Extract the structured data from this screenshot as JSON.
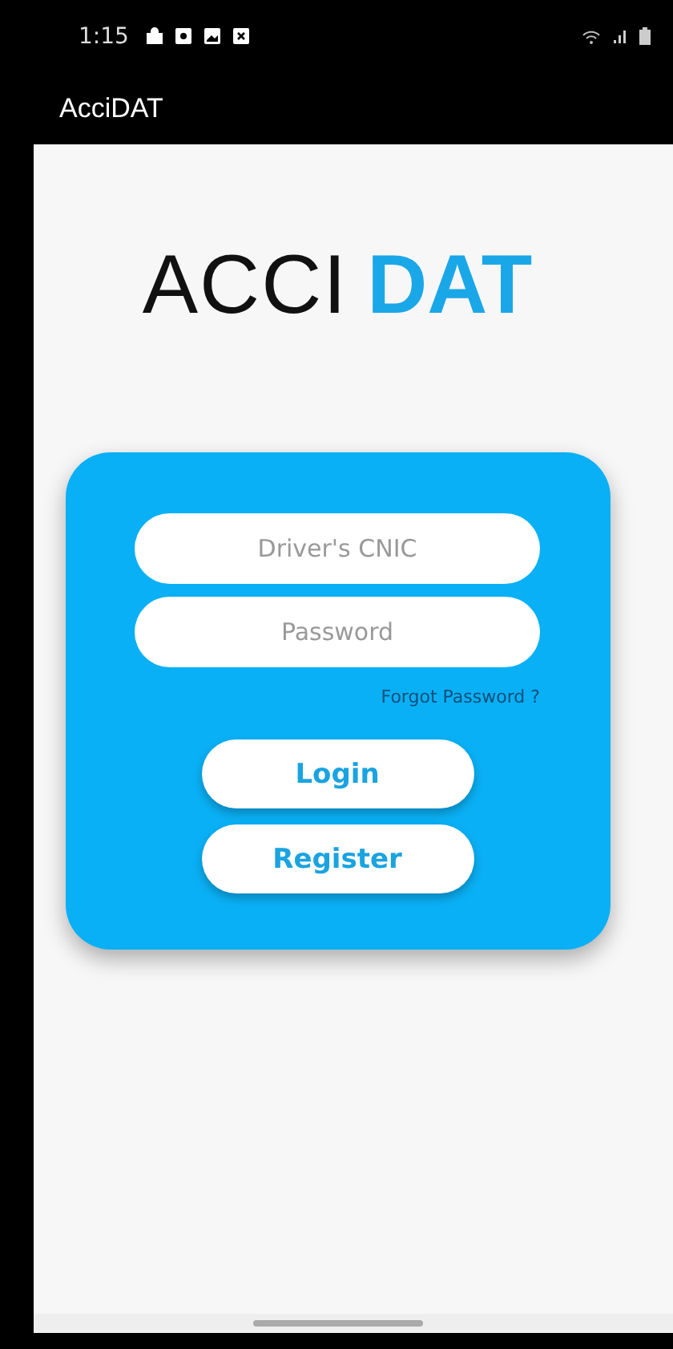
{
  "status_bar": {
    "time": "1:15"
  },
  "app_bar": {
    "title": "AcciDAT"
  },
  "logo": {
    "part_1": "ACCI",
    "part_2": "DAT"
  },
  "login_card": {
    "fields": [
      {
        "placeholder": "Driver's CNIC"
      },
      {
        "placeholder": "Password"
      }
    ],
    "forgot_link": "Forgot Password ?",
    "buttons": [
      "Login",
      "Register"
    ]
  }
}
